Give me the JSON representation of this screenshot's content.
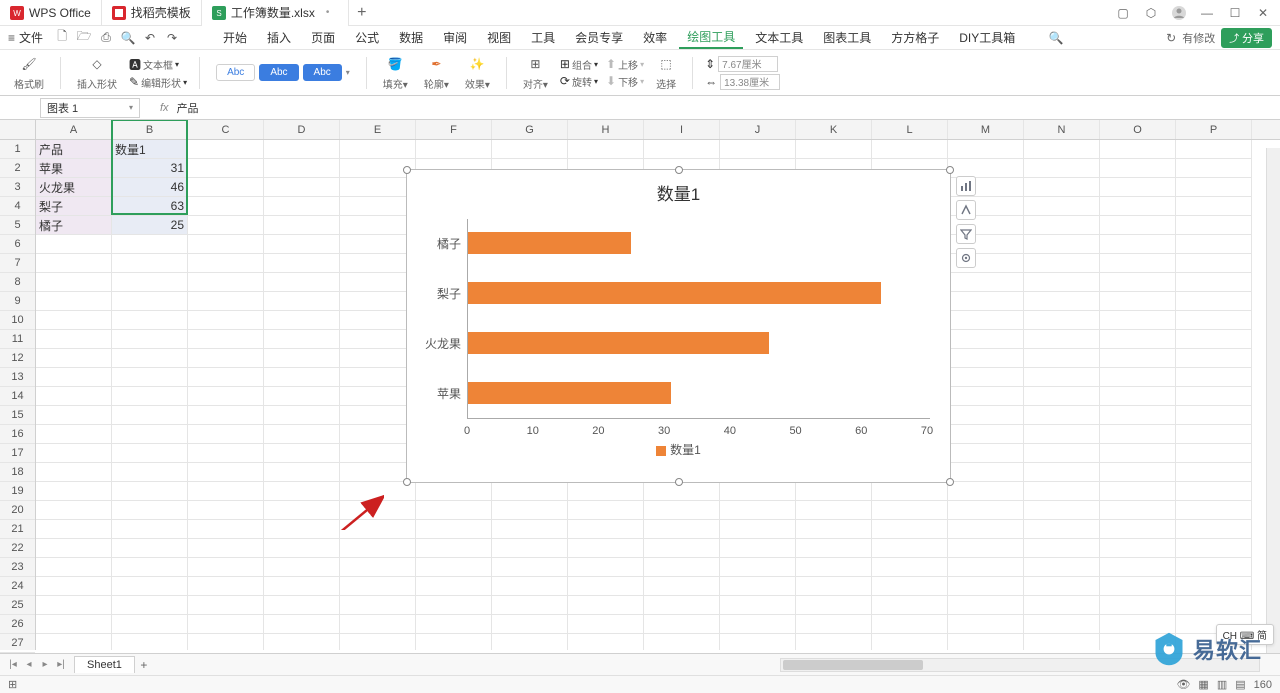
{
  "titlebar": {
    "app": "WPS Office",
    "tab2": "找稻壳模板",
    "tab3": "工作簿数量.xlsx"
  },
  "menu": {
    "file": "文件",
    "tabs": [
      "开始",
      "插入",
      "页面",
      "公式",
      "数据",
      "审阅",
      "视图",
      "工具",
      "会员专享",
      "效率",
      "绘图工具",
      "文本工具",
      "图表工具",
      "方方格子",
      "DIY工具箱"
    ],
    "modify": "有修改",
    "share": "分享"
  },
  "ribbon": {
    "paste": "格式刷",
    "insert_shape": "插入形状",
    "edit_shape": "编辑形状",
    "textbox": "文本框",
    "abc1": "Abc",
    "abc2": "Abc",
    "abc3": "Abc",
    "fill": "填充",
    "outline": "轮廓",
    "effect": "效果",
    "align": "对齐",
    "group": "组合",
    "rotate": "旋转",
    "up": "上移",
    "down": "下移",
    "select": "选择",
    "size_w": "7.67厘米",
    "size_h": "13.38厘米"
  },
  "formula": {
    "name": "图表 1",
    "fx": "fx",
    "content": "产品"
  },
  "columns": [
    "A",
    "B",
    "C",
    "D",
    "E",
    "F",
    "G",
    "H",
    "I",
    "J",
    "K",
    "L",
    "M",
    "N",
    "O",
    "P"
  ],
  "rows_count": 27,
  "cells": {
    "A1": "产品",
    "B1": "数量1",
    "A2": "苹果",
    "B2": "31",
    "A3": "火龙果",
    "B3": "46",
    "A4": "梨子",
    "B4": "63",
    "A5": "橘子",
    "B5": "25"
  },
  "chart_data": {
    "type": "bar",
    "title": "数量1",
    "categories": [
      "橘子",
      "梨子",
      "火龙果",
      "苹果"
    ],
    "values": [
      25,
      63,
      46,
      31
    ],
    "xticks": [
      0,
      10,
      20,
      30,
      40,
      50,
      60,
      70
    ],
    "legend": "数量1",
    "xlabel": "",
    "ylabel": "",
    "xlim": [
      0,
      70
    ]
  },
  "sheet": {
    "name": "Sheet1"
  },
  "status": {
    "zoom": "160",
    "ime": "CH ⌨ 简"
  },
  "watermark": "易软汇"
}
